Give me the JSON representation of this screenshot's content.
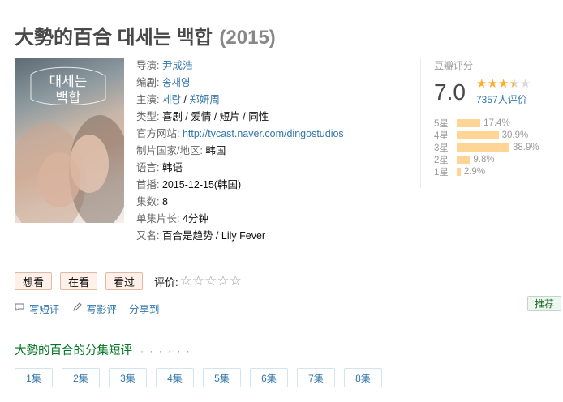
{
  "movie": {
    "title": "大勢的百合 대세는 백합",
    "year": "(2015)"
  },
  "info": [
    {
      "label": "导演:",
      "parts": [
        {
          "text": "尹成浩",
          "link": true
        }
      ]
    },
    {
      "label": "编剧:",
      "parts": [
        {
          "text": "송재영",
          "link": true
        }
      ]
    },
    {
      "label": "主演:",
      "parts": [
        {
          "text": "세랑",
          "link": true
        },
        {
          "text": " / ",
          "link": false
        },
        {
          "text": "郑妍周",
          "link": true
        }
      ]
    },
    {
      "label": "类型:",
      "parts": [
        {
          "text": "喜剧 / 爱情 / 短片 / 同性",
          "link": false
        }
      ]
    },
    {
      "label": "官方网站:",
      "parts": [
        {
          "text": "http://tvcast.naver.com/dingostudios",
          "link": true
        }
      ]
    },
    {
      "label": "制片国家/地区:",
      "parts": [
        {
          "text": "韩国",
          "link": false
        }
      ]
    },
    {
      "label": "语言:",
      "parts": [
        {
          "text": "韩语",
          "link": false
        }
      ]
    },
    {
      "label": "首播:",
      "parts": [
        {
          "text": "2015-12-15(韩国)",
          "link": false
        }
      ]
    },
    {
      "label": "集数:",
      "parts": [
        {
          "text": "8",
          "link": false
        }
      ]
    },
    {
      "label": "单集片长:",
      "parts": [
        {
          "text": "4分钟",
          "link": false
        }
      ]
    },
    {
      "label": "又名:",
      "parts": [
        {
          "text": "百合是趋势 / Lily Fever",
          "link": false
        }
      ]
    }
  ],
  "poster": {
    "text_line1": "대세는",
    "text_line2": "백합"
  },
  "rating": {
    "label": "豆瓣评分",
    "score": "7.0",
    "stars_filled": 3.5,
    "count": "7357人评价",
    "distribution": [
      {
        "label": "5星",
        "value": "17.4%",
        "pct": 17.4
      },
      {
        "label": "4星",
        "value": "30.9%",
        "pct": 30.9
      },
      {
        "label": "3星",
        "value": "38.9%",
        "pct": 38.9
      },
      {
        "label": "2星",
        "value": "9.8%",
        "pct": 9.8
      },
      {
        "label": "1星",
        "value": "2.9%",
        "pct": 2.9
      }
    ]
  },
  "actions": {
    "want": "想看",
    "watching": "在看",
    "watched": "看过",
    "rate_label": "评价:",
    "empty_stars": "☆☆☆☆☆"
  },
  "sub_actions": {
    "short_review": "写短评",
    "long_review": "写影评",
    "share": "分享到"
  },
  "recommend": "推荐",
  "section": {
    "title": "大勢的百合的分集短评",
    "dots": "· · · · · ·"
  },
  "episodes": [
    "1集",
    "2集",
    "3集",
    "4集",
    "5集",
    "6集",
    "7集",
    "8集"
  ],
  "colors": {
    "link": "#3377aa",
    "green": "#007722",
    "bar": "#ffd596",
    "star": "#ffac2d"
  }
}
